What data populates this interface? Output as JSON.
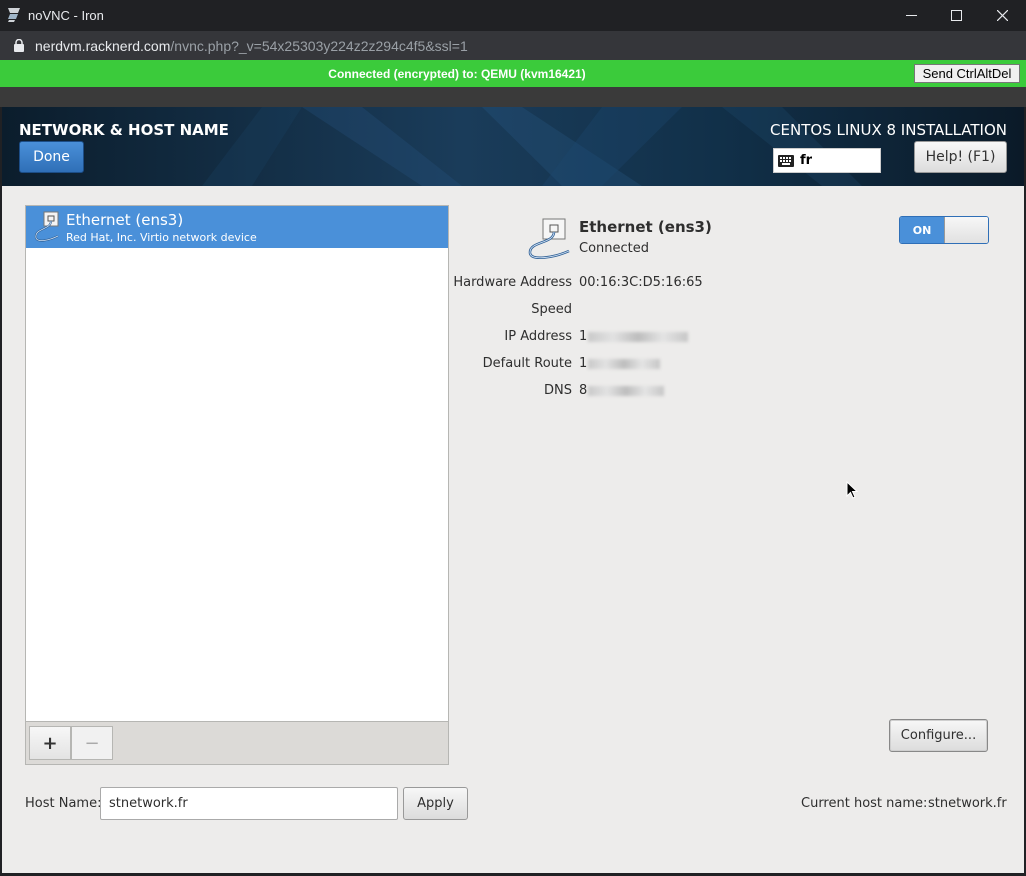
{
  "browser": {
    "window_title": "noVNC - Iron",
    "url_host": "nerdvm.racknerd.com",
    "url_path": "/nvnc.php?_v=54x25303y224z2z294c4f5&ssl=1"
  },
  "vnc": {
    "status": "Connected (encrypted) to: QEMU (kvm16421)",
    "send_ctrl_alt_del": "Send CtrlAltDel"
  },
  "header": {
    "title": "NETWORK & HOST NAME",
    "done_label": "Done",
    "install_title": "CENTOS LINUX 8 INSTALLATION",
    "keyboard_layout": "fr",
    "help_label": "Help! (F1)"
  },
  "device_list": {
    "items": [
      {
        "name": "Ethernet (ens3)",
        "description": "Red Hat, Inc. Virtio network device"
      }
    ],
    "add_label": "+",
    "remove_label": "−"
  },
  "details": {
    "name": "Ethernet (ens3)",
    "status": "Connected",
    "toggle_label": "ON",
    "rows": [
      {
        "label": "Hardware Address",
        "value": "00:16:3C:D5:16:65"
      },
      {
        "label": "Speed",
        "value": ""
      },
      {
        "label": "IP Address",
        "value": "1"
      },
      {
        "label": "Default Route",
        "value": "1"
      },
      {
        "label": "DNS",
        "value": "8"
      }
    ],
    "configure_label": "Configure..."
  },
  "hostname": {
    "label": "Host Name:",
    "value": "stnetwork.fr",
    "apply_label": "Apply",
    "current_label": "Current host name:",
    "current_value": "stnetwork.fr"
  }
}
